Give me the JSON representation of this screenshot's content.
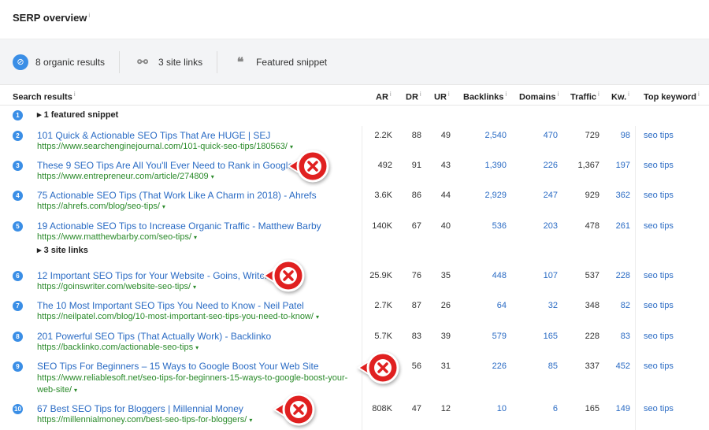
{
  "header": {
    "title": "SERP overview",
    "info": "i"
  },
  "summary": {
    "organic": {
      "icon": "leaf-icon",
      "glyph": "⊘",
      "label": "8 organic results"
    },
    "sitelinks": {
      "icon": "link-icon",
      "glyph": "⚯",
      "label": "3 site links"
    },
    "snippet": {
      "icon": "quote-icon",
      "glyph": "❝",
      "label": "Featured snippet"
    }
  },
  "columns": {
    "search_results": "Search results",
    "ar": "AR",
    "dr": "DR",
    "ur": "UR",
    "backlinks": "Backlinks",
    "domains": "Domains",
    "traffic": "Traffic",
    "kw": "Kw.",
    "top_keyword": "Top keyword",
    "info": "i"
  },
  "featured": {
    "num": "1",
    "label": "▸ 1 featured snippet"
  },
  "rows": [
    {
      "num": "2",
      "title": "101 Quick & Actionable SEO Tips That Are HUGE | SEJ",
      "url": "https://www.searchenginejournal.com/101-quick-seo-tips/180563/",
      "ar": "2.2K",
      "dr": "88",
      "ur": "49",
      "backlinks": "2,540",
      "domains": "470",
      "traffic": "729",
      "kw": "98",
      "top_keyword": "seo tips",
      "marked": false
    },
    {
      "num": "3",
      "title": "These 9 SEO Tips Are All You'll Ever Need to Rank in Google",
      "url": "https://www.entrepreneur.com/article/274809",
      "ar": "492",
      "dr": "91",
      "ur": "43",
      "backlinks": "1,390",
      "domains": "226",
      "traffic": "1,367",
      "kw": "197",
      "top_keyword": "seo tips",
      "marked": true
    },
    {
      "num": "4",
      "title": "75 Actionable SEO Tips (That Work Like A Charm in 2018) - Ahrefs",
      "url": "https://ahrefs.com/blog/seo-tips/",
      "ar": "3.6K",
      "dr": "86",
      "ur": "44",
      "backlinks": "2,929",
      "domains": "247",
      "traffic": "929",
      "kw": "362",
      "top_keyword": "seo tips",
      "marked": false
    },
    {
      "num": "5",
      "title": "19 Actionable SEO Tips to Increase Organic Traffic - Matthew Barby",
      "url": "https://www.matthewbarby.com/seo-tips/",
      "ar": "140K",
      "dr": "67",
      "ur": "40",
      "backlinks": "536",
      "domains": "203",
      "traffic": "478",
      "kw": "261",
      "top_keyword": "seo tips",
      "sitelinks": "▸ 3 site links",
      "marked": false
    },
    {
      "num": "6",
      "title": "12 Important SEO Tips for Your Website - Goins, Writer",
      "url": "https://goinswriter.com/website-seo-tips/",
      "ar": "25.9K",
      "dr": "76",
      "ur": "35",
      "backlinks": "448",
      "domains": "107",
      "traffic": "537",
      "kw": "228",
      "top_keyword": "seo tips",
      "marked": true
    },
    {
      "num": "7",
      "title": "The 10 Most Important SEO Tips You Need to Know - Neil Patel",
      "url": "https://neilpatel.com/blog/10-most-important-seo-tips-you-need-to-know/",
      "ar": "2.7K",
      "dr": "87",
      "ur": "26",
      "backlinks": "64",
      "domains": "32",
      "traffic": "348",
      "kw": "82",
      "top_keyword": "seo tips",
      "marked": false
    },
    {
      "num": "8",
      "title": "201 Powerful SEO Tips (That Actually Work) - Backlinko",
      "url": "https://backlinko.com/actionable-seo-tips",
      "ar": "5.7K",
      "dr": "83",
      "ur": "39",
      "backlinks": "579",
      "domains": "165",
      "traffic": "228",
      "kw": "83",
      "top_keyword": "seo tips",
      "marked": false
    },
    {
      "num": "9",
      "title": "SEO Tips For Beginners – 15 Ways to Google Boost Your Web Site",
      "url": "https://www.reliablesoft.net/seo-tips-for-beginners-15-ways-to-google-boost-your-web-site/",
      "ar": "",
      "dr": "56",
      "ur": "31",
      "backlinks": "226",
      "domains": "85",
      "traffic": "337",
      "kw": "452",
      "top_keyword": "seo tips",
      "marked": true
    },
    {
      "num": "10",
      "title": "67 Best SEO Tips for Bloggers | Millennial Money",
      "url": "https://millennialmoney.com/best-seo-tips-for-bloggers/",
      "ar": "808K",
      "dr": "47",
      "ur": "12",
      "backlinks": "10",
      "domains": "6",
      "traffic": "165",
      "kw": "149",
      "top_keyword": "seo tips",
      "marked": true
    }
  ],
  "url_arrow": "▾",
  "colors": {
    "accent": "#3a8ee6",
    "link": "#2a6bc4",
    "url": "#2a8a2a",
    "mark": "#e02020"
  }
}
